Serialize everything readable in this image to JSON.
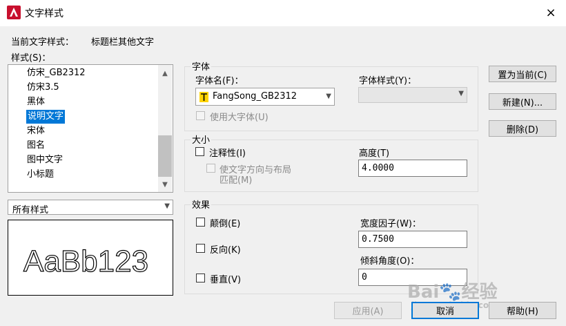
{
  "window": {
    "title": "文字样式",
    "close_icon": "×"
  },
  "current_style": {
    "label": "当前文字样式：",
    "value": "标题栏其他文字"
  },
  "styles_list": {
    "label": "样式(S)：",
    "items": [
      "仿宋_GB2312",
      "仿宋3.5",
      "黑体",
      "说明文字",
      "宋体",
      "图名",
      "图中文字",
      "小标题"
    ],
    "selected_index": 3
  },
  "filter": {
    "value": "所有样式"
  },
  "preview": {
    "text": "AaBb123"
  },
  "font": {
    "group_label": "字体",
    "name_label": "字体名(F)：",
    "name_value": "FangSong_GB2312",
    "style_label": "字体样式(Y)：",
    "style_value": "",
    "big_font_label": "使用大字体(U)",
    "big_font_checked": false
  },
  "size": {
    "group_label": "大小",
    "annotative_label": "注释性(I)",
    "annotative_checked": false,
    "match_layout_label_1": "使文字方向与布局",
    "match_layout_label_2": "匹配(M)",
    "height_label": "高度(T)",
    "height_value": "4.0000"
  },
  "effects": {
    "group_label": "效果",
    "upside_down_label": "颠倒(E)",
    "backwards_label": "反向(K)",
    "vertical_label": "垂直(V)",
    "width_factor_label": "宽度因子(W)：",
    "width_factor_value": "0.7500",
    "oblique_label": "倾斜角度(O)：",
    "oblique_value": "0"
  },
  "buttons": {
    "set_current": "置为当前(C)",
    "new": "新建(N)...",
    "delete": "删除(D)",
    "apply": "应用(A)",
    "cancel": "取消",
    "help": "帮助(H)"
  },
  "watermark": {
    "brand": "Bai",
    "brand2": "经验",
    "url": "jingyan.baidu.com"
  },
  "colors": {
    "selection": "#0078d7",
    "title_bar": "#ffffff",
    "dialog_bg": "#f0f0f0",
    "app_icon": "#c8102e"
  }
}
